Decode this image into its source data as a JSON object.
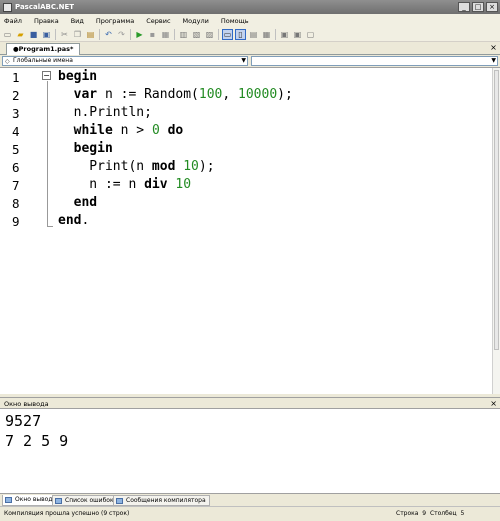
{
  "window": {
    "title": "PascalABC.NET"
  },
  "menu": [
    "Файл",
    "Правка",
    "Вид",
    "Программа",
    "Сервис",
    "Модули",
    "Помощь"
  ],
  "tab": {
    "label": "●Program1.pas*"
  },
  "selector": {
    "left": "Глобальные имена",
    "right": ""
  },
  "editor": {
    "line_numbers": [
      "1",
      "2",
      "3",
      "4",
      "5",
      "6",
      "7",
      "8",
      "9"
    ]
  },
  "output": {
    "title": "Окно вывода",
    "lines": [
      "9527",
      "7 2 5 9"
    ]
  },
  "bottom_tabs": [
    "Окно вывода",
    "Список ошибок",
    "Сообщения компилятора"
  ],
  "status": {
    "message": "Компиляция прошла успешно (9 строк)",
    "row_label": "Строка",
    "row": "9",
    "col_label": "Столбец",
    "col": "5"
  }
}
